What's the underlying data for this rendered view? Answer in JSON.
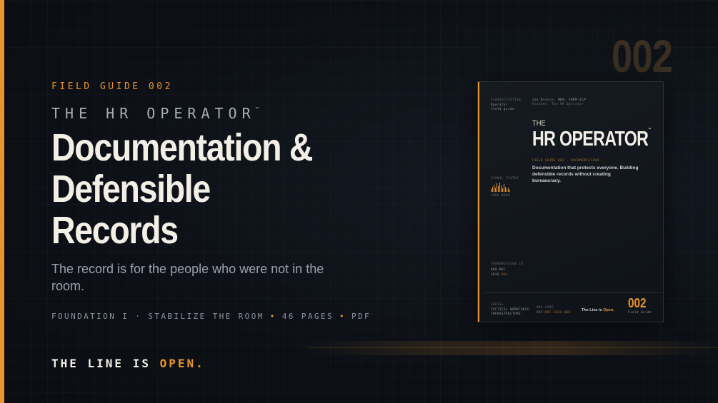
{
  "eyebrow": "FIELD GUIDE 002",
  "series": {
    "name": "THE HR OPERATOR",
    "tm": "™"
  },
  "title": {
    "line1": "Documentation &",
    "line2": "Defensible",
    "line3": "Records"
  },
  "subtitle": "The record is for the people who were not in the room.",
  "meta": {
    "foundation": "FOUNDATION I · STABILIZE THE ROOM",
    "pages": "46 PAGES",
    "format": "PDF"
  },
  "tagline": {
    "prefix": "THE LINE IS ",
    "highlight": "OPEN."
  },
  "big_number": "002",
  "cover": {
    "classification_label": "CLASSIFICATION",
    "classification_value": "Operator field guide",
    "author": "Joe Brusco, MBA, SHRM-SCP",
    "author_role": "Founder, The HR Operator",
    "the": "THE",
    "title": "HR OPERATOR",
    "tm": "™",
    "guide_label": "FIELD GUIDE 002 · DOCUMENTATION",
    "description": "Documentation that protects everyone. Building defensible records without creating bureaucracy.",
    "signal_label": "SIGNAL STATUS",
    "signal_value": "CODE 0000",
    "transmission_label": "TRANSMISSION ID",
    "transmission_value": "HRO-DOC",
    "transmission_year": "2026",
    "transmission_num": "002",
    "series_label": "SERIES",
    "series_value": "TACTICAL WORKFORCE INFRASTRUCTURE",
    "code_label": "HRO CODE",
    "code_value": "HRO-DOC-2026-002",
    "line_prefix": "The Line is ",
    "line_highlight": "Open.",
    "number": "002",
    "number_label": "Field Guide"
  },
  "colors": {
    "accent": "#e8942f",
    "background": "#0d1117",
    "text": "#f3efe6"
  }
}
